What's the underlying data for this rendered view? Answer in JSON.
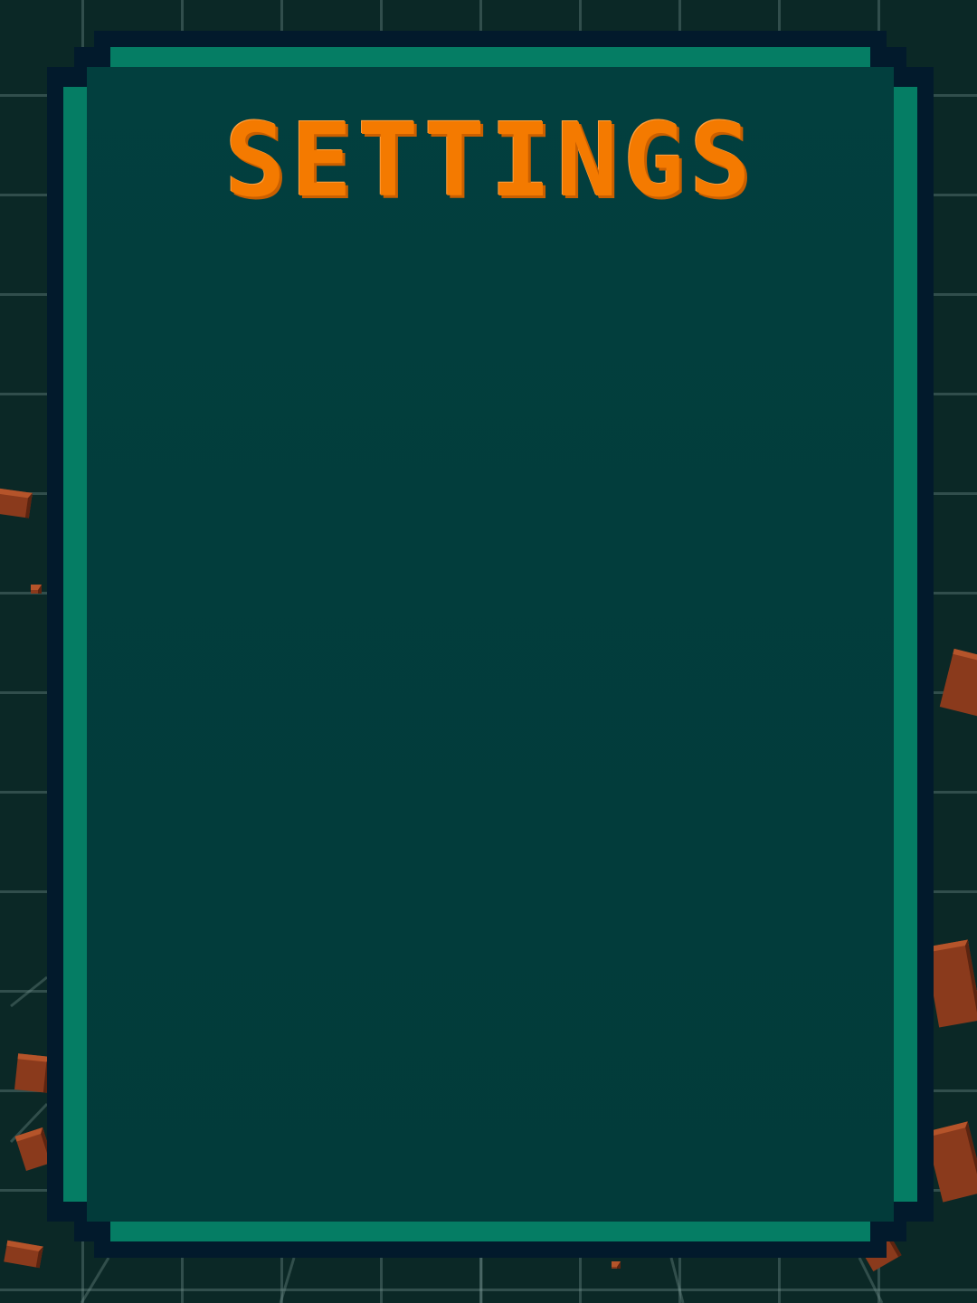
{
  "screen": {
    "title": "SETTINGS"
  },
  "colors": {
    "title": "#f47a00",
    "panel_fill": "#023f3e",
    "panel_border_light": "#057d64",
    "panel_border_dark": "#021a2c",
    "background": "#0b2826",
    "debris": "#8a3a1c"
  }
}
